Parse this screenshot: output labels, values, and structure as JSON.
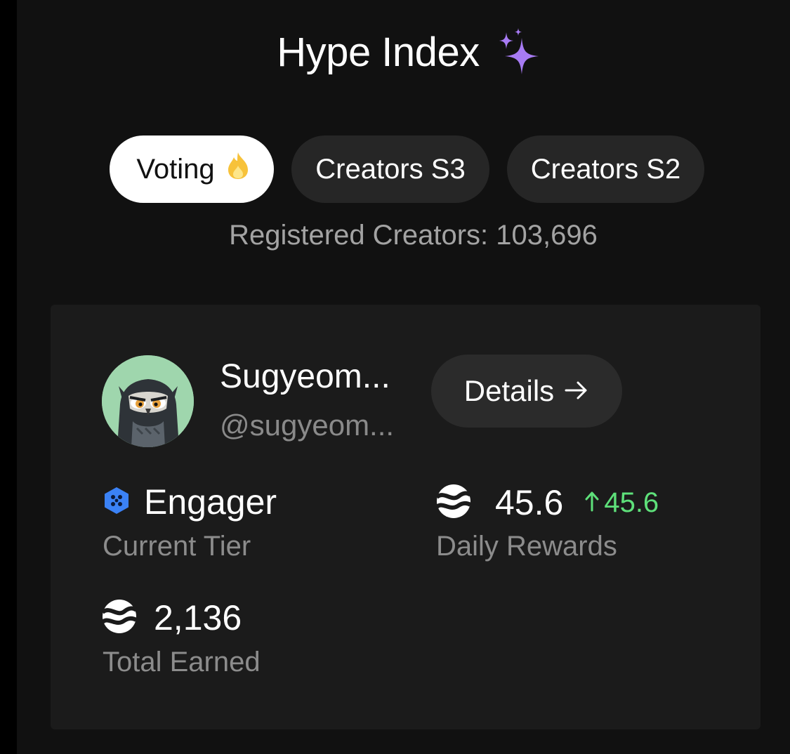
{
  "header": {
    "title": "Hype Index",
    "title_icon": "sparkles-icon"
  },
  "tabs": [
    {
      "label": "Voting",
      "icon": "flame-icon",
      "active": true
    },
    {
      "label": "Creators S3",
      "active": false
    },
    {
      "label": "Creators S2",
      "active": false
    }
  ],
  "registered_creators": "Registered Creators: 103,696",
  "profile": {
    "name": "Sugyeom...",
    "handle": "@sugyeom...",
    "avatar": "owl-avatar",
    "details_label": "Details",
    "details_icon": "arrow-right-icon"
  },
  "stats": {
    "tier": {
      "value": "Engager",
      "label": "Current Tier",
      "icon": "hexagon-tier-icon"
    },
    "daily_rewards": {
      "value": "45.6",
      "change": "45.6",
      "change_icon": "arrow-up-icon",
      "label": "Daily Rewards",
      "icon": "token-icon"
    },
    "total_earned": {
      "value": "2,136",
      "label": "Total Earned",
      "icon": "token-icon"
    }
  },
  "colors": {
    "accent_purple": "#a77bf3",
    "positive_green": "#5ee07a",
    "tier_blue": "#3b82f6",
    "flame_yellow": "#f7c23a"
  }
}
